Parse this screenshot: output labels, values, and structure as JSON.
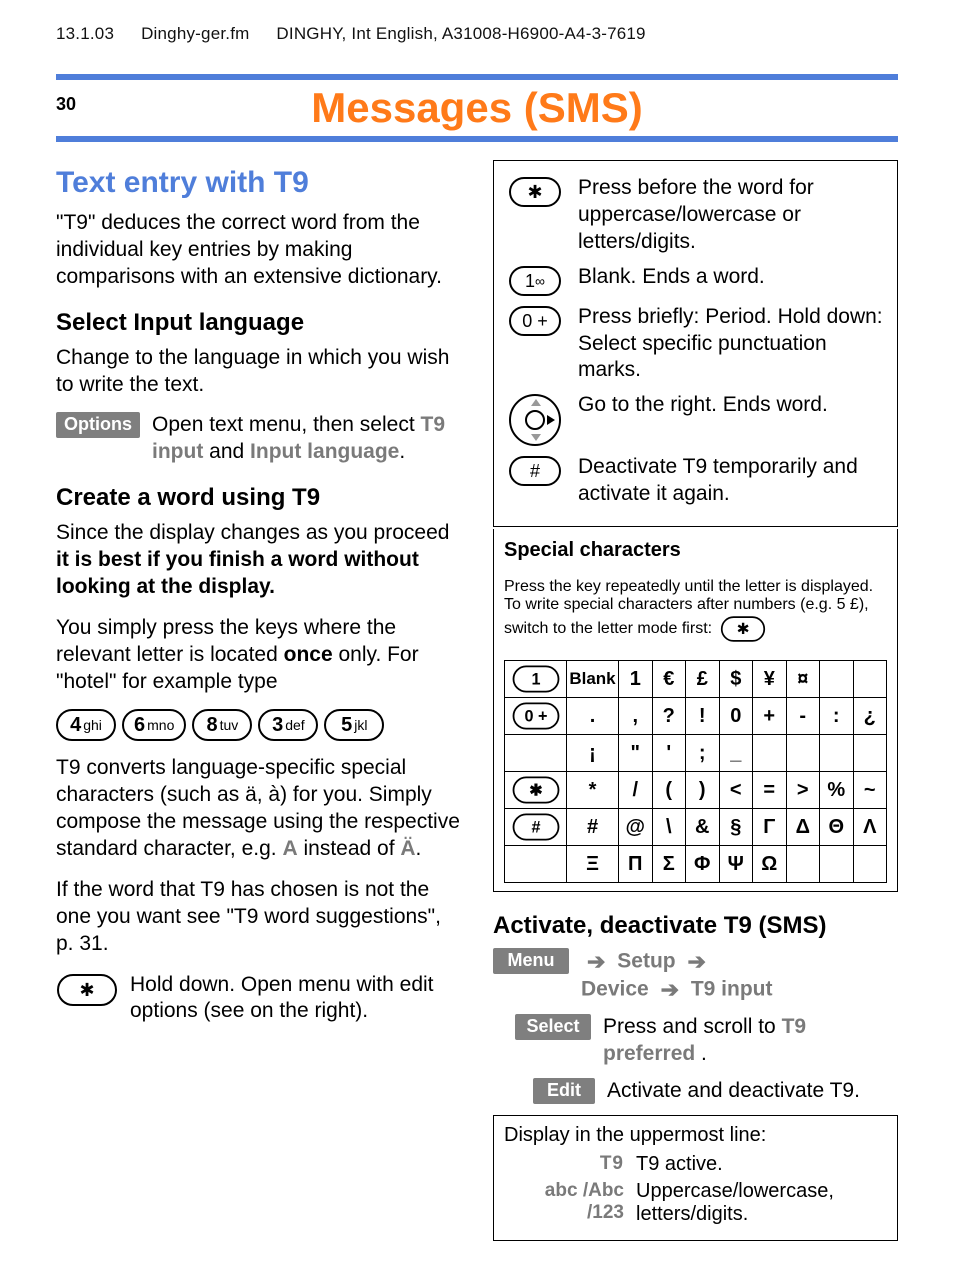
{
  "running_head": {
    "date": "13.1.03",
    "file": "Dinghy-ger.fm",
    "doc": "DINGHY, Int English, A31008-H6900-A4-3-7619"
  },
  "page_number": "30",
  "chapter_title": "Messages (SMS)",
  "left": {
    "h2": "Text entry with T9",
    "intro": "\"T9\" deduces the correct word from the individual key entries by making comparisons with an extensive dictionary.",
    "sub1": "Select Input language",
    "sub1_body": "Change to the language in which you wish to write the text.",
    "options_label": "Options",
    "options_text_pre": "Open text menu, then select ",
    "options_text_t9": "T9 input",
    "options_text_and": " and ",
    "options_text_inp": "Input language",
    "options_text_post": ".",
    "sub2": "Create a word using T9",
    "sub2_body1_pre": "Since the display changes as you proceed ",
    "sub2_body1_bold": "it is best if you finish a word without looking at the display.",
    "sub2_body2_pre": "You simply press the keys where the relevant letter is located ",
    "sub2_body2_bold": "once",
    "sub2_body2_post": " only. For \"hotel\" for example type",
    "keys": [
      {
        "num": "4",
        "sub": "ghi"
      },
      {
        "num": "6",
        "sub": "mno"
      },
      {
        "num": "8",
        "sub": "tuv"
      },
      {
        "num": "3",
        "sub": "def"
      },
      {
        "num": "5",
        "sub": "jkl"
      }
    ],
    "p_convert_pre": "T9 converts language-specific special characters (such as ä, à) for you. Simply compose the message using the respective standard character, e.g. ",
    "p_convert_A": "A",
    "p_convert_mid": " instead of ",
    "p_convert_Au": "Ä",
    "p_convert_post": ".",
    "p_wordsugg": "If the word that T9 has chosen is not the one you want see \"T9 word suggestions\", p. 31.",
    "star_hold": "Hold down. Open menu with edit options (see on the right).",
    "star_glyph": "✱"
  },
  "right": {
    "list": [
      {
        "key": "star",
        "glyph": "✱",
        "text": "Press before the word for uppercase/lowercase or letters/digits."
      },
      {
        "key": "1",
        "glyph": "1",
        "sub": "∞",
        "text": "Blank. Ends a word."
      },
      {
        "key": "0",
        "glyph": "0 +",
        "text": "Press briefly: Period. Hold down: Select specific punctuation marks."
      },
      {
        "key": "nav",
        "text": "Go to the right. Ends word."
      },
      {
        "key": "hash",
        "glyph": "#",
        "text": "Deactivate T9 temporarily and activate it again."
      }
    ],
    "special_title": "Special characters",
    "special_body": "Press the key repeatedly until the letter is displayed. To write special characters after numbers (e.g. 5 £), switch to the letter mode first:",
    "special_body_glyph": "✱",
    "table": {
      "rows": [
        {
          "keyglyph": "1",
          "cells": [
            "Blank",
            "1",
            "€",
            "£",
            "$",
            "¥",
            "¤",
            "",
            ""
          ]
        },
        {
          "keyglyph": "0 +",
          "cells": [
            ".",
            ",",
            "?",
            "!",
            "0",
            "+",
            "-",
            ":",
            "¿"
          ]
        },
        {
          "keyglyph": "",
          "cells": [
            "¡",
            "\"",
            "'",
            ";",
            "_",
            "",
            "",
            "",
            ""
          ]
        },
        {
          "keyglyph": "✱",
          "cells": [
            "*",
            "/",
            "(",
            ")",
            "<",
            "=",
            ">",
            "%",
            "~"
          ]
        },
        {
          "keyglyph": "#",
          "cells": [
            "#",
            "@",
            "\\",
            "&",
            "§",
            "Γ",
            "Δ",
            "Θ",
            "Λ"
          ]
        },
        {
          "keyglyph": "",
          "cells": [
            "Ξ",
            "Π",
            "Σ",
            "Φ",
            "Ψ",
            "Ω",
            "",
            "",
            ""
          ]
        }
      ]
    },
    "activate_h3": "Activate, deactivate T9 (SMS)",
    "menu_label": "Menu",
    "menu_setup": "Setup",
    "menu_device": "Device",
    "menu_t9": "T9 input",
    "select_label": "Select",
    "select_text_pre": "Press and scroll to ",
    "select_text_bold": "T9 preferred ",
    "select_text_post": ".",
    "edit_label": "Edit",
    "edit_text": "Activate and deactivate T9.",
    "display_title": "Display in the uppermost line:",
    "disp_rows": [
      {
        "label": "T9",
        "text": "T9 active."
      },
      {
        "label": "abc /Abc /123",
        "text": "Uppercase/lowercase, letters/digits."
      }
    ]
  },
  "chart_data": null
}
